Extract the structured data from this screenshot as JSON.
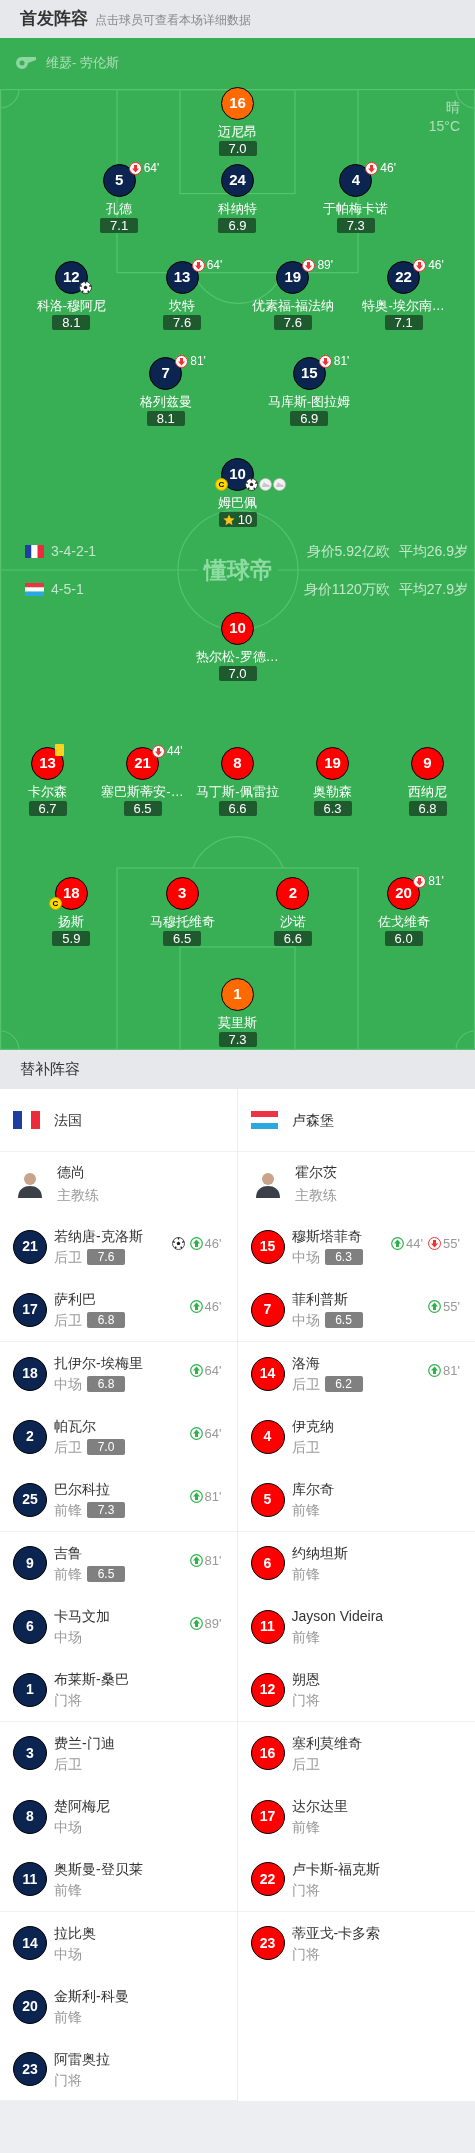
{
  "header": {
    "title": "首发阵容",
    "hint": "点击球员可查看本场详细数据"
  },
  "referee": "维瑟- 劳伦斯",
  "weather": {
    "condition": "晴",
    "temperature": "15°C"
  },
  "pitch_logo": "懂球帝",
  "teams": [
    {
      "flag": {
        "kind": "france"
      },
      "formation": "3-4-2-1",
      "value": "身价5.92亿欧",
      "average_age": "平均26.9岁",
      "lines": [
        {
          "players": [
            {
              "number": "16",
              "name": "迈尼昂",
              "rating": "7.0",
              "color": "#ff6a00",
              "top_rated": false
            }
          ]
        },
        {
          "players": [
            {
              "number": "5",
              "name": "孔德",
              "rating": "7.1",
              "color": "#0c2450",
              "top_rated": false,
              "events": [
                {
                  "kind": "off",
                  "minute": "64'"
                }
              ]
            },
            {
              "number": "24",
              "name": "科纳特",
              "rating": "6.9",
              "color": "#0c2450",
              "top_rated": false
            },
            {
              "number": "4",
              "name": "于帕梅卡诺",
              "rating": "7.3",
              "color": "#0c2450",
              "top_rated": false,
              "events": [
                {
                  "kind": "off",
                  "minute": "46'"
                }
              ]
            }
          ]
        },
        {
          "players": [
            {
              "number": "12",
              "name": "科洛-穆阿尼",
              "rating": "8.1",
              "color": "#0c2450",
              "top_rated": false,
              "events": [
                {
                  "kind": "goal"
                }
              ]
            },
            {
              "number": "13",
              "name": "坎特",
              "rating": "7.6",
              "color": "#0c2450",
              "top_rated": false,
              "events": [
                {
                  "kind": "off",
                  "minute": "64'"
                }
              ]
            },
            {
              "number": "19",
              "name": "优素福-福法纳",
              "rating": "7.6",
              "color": "#0c2450",
              "top_rated": false,
              "events": [
                {
                  "kind": "off",
                  "minute": "89'"
                }
              ]
            },
            {
              "number": "22",
              "name": "特奥-埃尔南…",
              "rating": "7.1",
              "color": "#0c2450",
              "top_rated": false,
              "events": [
                {
                  "kind": "off",
                  "minute": "46'"
                }
              ]
            }
          ]
        },
        {
          "players": [
            {
              "number": "7",
              "name": "格列兹曼",
              "rating": "8.1",
              "color": "#0c2450",
              "top_rated": false,
              "events": [
                {
                  "kind": "off",
                  "minute": "81'"
                }
              ]
            },
            {
              "number": "15",
              "name": "马库斯-图拉姆",
              "rating": "6.9",
              "color": "#0c2450",
              "top_rated": false,
              "events": [
                {
                  "kind": "off",
                  "minute": "81'"
                }
              ]
            }
          ]
        },
        {
          "players": [
            {
              "number": "10",
              "name": "姆巴佩",
              "rating": "10",
              "color": "#0c2450",
              "top_rated": true,
              "events": [
                {
                  "kind": "captain",
                  "label": "C"
                },
                {
                  "kind": "goal"
                },
                {
                  "kind": "assist"
                },
                {
                  "kind": "assist"
                }
              ]
            }
          ]
        }
      ]
    },
    {
      "flag": {
        "kind": "luxembourg"
      },
      "formation": "4-5-1",
      "value": "身价1120万欧",
      "average_age": "平均27.9岁",
      "lines": [
        {
          "players": [
            {
              "number": "10",
              "name": "热尔松-罗德…",
              "rating": "7.0",
              "color": "#ff0000",
              "top_rated": false
            }
          ]
        },
        {
          "players": [
            {
              "number": "13",
              "name": "卡尔森",
              "rating": "6.7",
              "color": "#ff0000",
              "top_rated": false,
              "events": [
                {
                  "kind": "yellow_card"
                }
              ]
            },
            {
              "number": "21",
              "name": "塞巴斯蒂安-…",
              "rating": "6.5",
              "color": "#ff0000",
              "top_rated": false,
              "events": [
                {
                  "kind": "off",
                  "minute": "44'"
                }
              ]
            },
            {
              "number": "8",
              "name": "马丁斯-佩雷拉",
              "rating": "6.6",
              "color": "#ff0000",
              "top_rated": false
            },
            {
              "number": "19",
              "name": "奥勒森",
              "rating": "6.3",
              "color": "#ff0000",
              "top_rated": false
            },
            {
              "number": "9",
              "name": "西纳尼",
              "rating": "6.8",
              "color": "#ff0000",
              "top_rated": false
            }
          ]
        },
        {
          "players": [
            {
              "number": "18",
              "name": "扬斯",
              "rating": "5.9",
              "color": "#ff0000",
              "top_rated": false,
              "events": [
                {
                  "kind": "captain",
                  "label": "C"
                }
              ]
            },
            {
              "number": "3",
              "name": "马穆托维奇",
              "rating": "6.5",
              "color": "#ff0000",
              "top_rated": false
            },
            {
              "number": "2",
              "name": "沙诺",
              "rating": "6.6",
              "color": "#ff0000",
              "top_rated": false
            },
            {
              "number": "20",
              "name": "佐戈维奇",
              "rating": "6.0",
              "color": "#ff0000",
              "top_rated": false,
              "events": [
                {
                  "kind": "off",
                  "minute": "81'"
                }
              ]
            }
          ]
        },
        {
          "players": [
            {
              "number": "1",
              "name": "莫里斯",
              "rating": "7.3",
              "color": "#ff6a00",
              "top_rated": false
            }
          ]
        }
      ]
    }
  ],
  "subs": {
    "title": "替补阵容",
    "teams": [
      {
        "name": "法国",
        "flag": {
          "kind": "france"
        },
        "color": "#0c2450",
        "coach": {
          "name": "德尚",
          "role": "主教练"
        },
        "players": [
          {
            "number": "21",
            "name": "若纳唐-克洛斯",
            "position": "后卫",
            "rating": "7.6",
            "events": [
              {
                "kind": "goal"
              },
              {
                "kind": "in",
                "minute": "46'"
              }
            ]
          },
          {
            "number": "17",
            "name": "萨利巴",
            "position": "后卫",
            "rating": "6.8",
            "events": [
              {
                "kind": "in",
                "minute": "46'"
              }
            ]
          },
          {
            "number": "18",
            "name": "扎伊尔-埃梅里",
            "position": "中场",
            "rating": "6.8",
            "events": [
              {
                "kind": "in",
                "minute": "64'"
              }
            ]
          },
          {
            "number": "2",
            "name": "帕瓦尔",
            "position": "后卫",
            "rating": "7.0",
            "events": [
              {
                "kind": "in",
                "minute": "64'"
              }
            ]
          },
          {
            "number": "25",
            "name": "巴尔科拉",
            "position": "前锋",
            "rating": "7.3",
            "events": [
              {
                "kind": "in",
                "minute": "81'"
              }
            ]
          },
          {
            "number": "9",
            "name": "吉鲁",
            "position": "前锋",
            "rating": "6.5",
            "events": [
              {
                "kind": "in",
                "minute": "81'"
              }
            ]
          },
          {
            "number": "6",
            "name": "卡马文加",
            "position": "中场",
            "events": [
              {
                "kind": "in",
                "minute": "89'"
              }
            ]
          },
          {
            "number": "1",
            "name": "布莱斯-桑巴",
            "position": "门将"
          },
          {
            "number": "3",
            "name": "费兰-门迪",
            "position": "后卫"
          },
          {
            "number": "8",
            "name": "楚阿梅尼",
            "position": "中场"
          },
          {
            "number": "11",
            "name": "奥斯曼-登贝莱",
            "position": "前锋"
          },
          {
            "number": "14",
            "name": "拉比奥",
            "position": "中场"
          },
          {
            "number": "20",
            "name": "金斯利-科曼",
            "position": "前锋"
          },
          {
            "number": "23",
            "name": "阿雷奥拉",
            "position": "门将"
          }
        ]
      },
      {
        "name": "卢森堡",
        "flag": {
          "kind": "luxembourg"
        },
        "color": "#ff0000",
        "coach": {
          "name": "霍尔茨",
          "role": "主教练"
        },
        "players": [
          {
            "number": "15",
            "name": "穆斯塔菲奇",
            "position": "中场",
            "rating": "6.3",
            "events": [
              {
                "kind": "in",
                "minute": "44'"
              },
              {
                "kind": "off",
                "minute": "55'"
              }
            ]
          },
          {
            "number": "7",
            "name": "菲利普斯",
            "position": "中场",
            "rating": "6.5",
            "events": [
              {
                "kind": "in",
                "minute": "55'"
              }
            ]
          },
          {
            "number": "14",
            "name": "洛海",
            "position": "后卫",
            "rating": "6.2",
            "events": [
              {
                "kind": "in",
                "minute": "81'"
              }
            ]
          },
          {
            "number": "4",
            "name": "伊克纳",
            "position": "后卫"
          },
          {
            "number": "5",
            "name": "库尔奇",
            "position": "前锋"
          },
          {
            "number": "6",
            "name": "约纳坦斯",
            "position": "前锋"
          },
          {
            "number": "11",
            "name": "Jayson Videira",
            "position": "前锋"
          },
          {
            "number": "12",
            "name": "朔恩",
            "position": "门将"
          },
          {
            "number": "16",
            "name": "塞利莫维奇",
            "position": "后卫"
          },
          {
            "number": "17",
            "name": "达尔达里",
            "position": "前锋"
          },
          {
            "number": "22",
            "name": "卢卡斯-福克斯",
            "position": "门将"
          },
          {
            "number": "23",
            "name": "蒂亚戈-卡多索",
            "position": "门将"
          }
        ]
      }
    ]
  }
}
